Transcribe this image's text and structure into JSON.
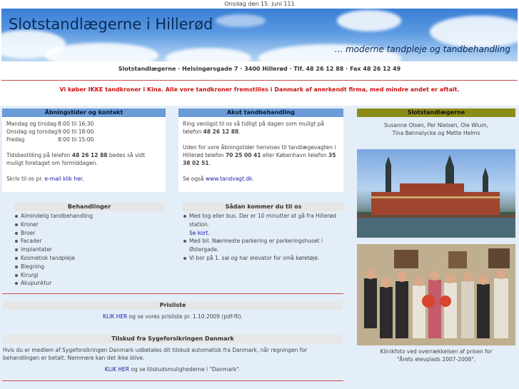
{
  "date_line": "Onsdag den 15. juni 111",
  "banner": {
    "title": "Slotstandlægerne i Hillerød",
    "tagline": "... moderne tandpleje og tandbehandling"
  },
  "address": "Slotstandlægerne · Helsingørsgade 7 · 3400 Hillerød · Tlf. 48 26 12 88 · Fax 48 26 12 49",
  "notice": "Vi køber IKKE tandkroner i Kina. Alle vore tandkroner fremstilles i Danmark af anerkendt firma, med mindre andet er aftalt.",
  "hours": {
    "heading": "Åbningstider og kontakt",
    "rows": [
      {
        "day": "Mandag og tirsdag",
        "time": "8:00 til 16:30"
      },
      {
        "day": "Onsdag og torsdag",
        "time": "9:00 til 18:00"
      },
      {
        "day": "Fredag",
        "time": "8:00 til 15:00"
      }
    ],
    "booking_pre": "Tidsbestilling på telefon ",
    "booking_phone": "48 26 12 88",
    "booking_post": " bedes så vidt muligt foretaget om formiddagen.",
    "mail_pre": "Skriv til os pr. ",
    "mail_link": "e-mail klik her",
    "mail_post": "."
  },
  "acute": {
    "heading": "Akut tandbehandling",
    "p1_pre": "Ring venligst til os så tidligt på dagen som muligt på telefon ",
    "p1_phone": "48 26 12 88",
    "p1_post": ".",
    "p2_a": "Uden for vore åbningstider henvises til tandlægevagten i Hillerød telefon ",
    "p2_phone1": "70 25 00 41",
    "p2_b": " eller København telefon ",
    "p2_phone2": "35 38 02 51",
    "p2_c": ".",
    "p3_pre": "Se også ",
    "p3_link": "www.tandvagt.dk",
    "p3_post": "."
  },
  "treatments": {
    "heading": "Behandlinger",
    "items": [
      "Almindelig tandbehandling",
      "Kroner",
      "Broer",
      "Facader",
      "Implantater",
      "Kosmetisk tandpleje",
      "Blegning",
      "Kirurgi",
      "Akupunktur"
    ]
  },
  "directions": {
    "heading": "Sådan kommer du til os",
    "item1_pre": "Med tog eller bus. Der er 10 minutter at gå fra Hillerød station.",
    "item1_link": "Se kort",
    "item1_post": ".",
    "item2": "Med bil. Nærmeste parkering er parkeringshuset i Østergade.",
    "item3": "Vi bor på 1. sal og har elevator for små køretøje."
  },
  "prices": {
    "heading": "Prisliste",
    "link": "KLIK HER",
    "text": " og se vores prisliste pr. 1.10.2009 (pdf-fil)."
  },
  "subsidy": {
    "heading": "Tilskud fra Sygeforsikringen Danmark",
    "text": "Hvis du er medlem af Sygeforsikringen Danmark udbetales dit tilskud automatisk fra Danmark, når regningen for behandlingen er betalt. Nemmere kan det ikke blive.",
    "link": "KLIK HER",
    "link_post": " og se tilskudsmulighederne i \"Danmark\"."
  },
  "sidebar": {
    "heading": "Slotstandlægerne",
    "names1": "Susanne Olsen, Per Nielsen, Ole Wium,",
    "names2": "Tina Bønnelycke og Mette Helms",
    "caption1": "Klinikfoto ved overrækkelsen af prisen for",
    "caption2": "\"Årets elevplads 2007-2008\"."
  }
}
